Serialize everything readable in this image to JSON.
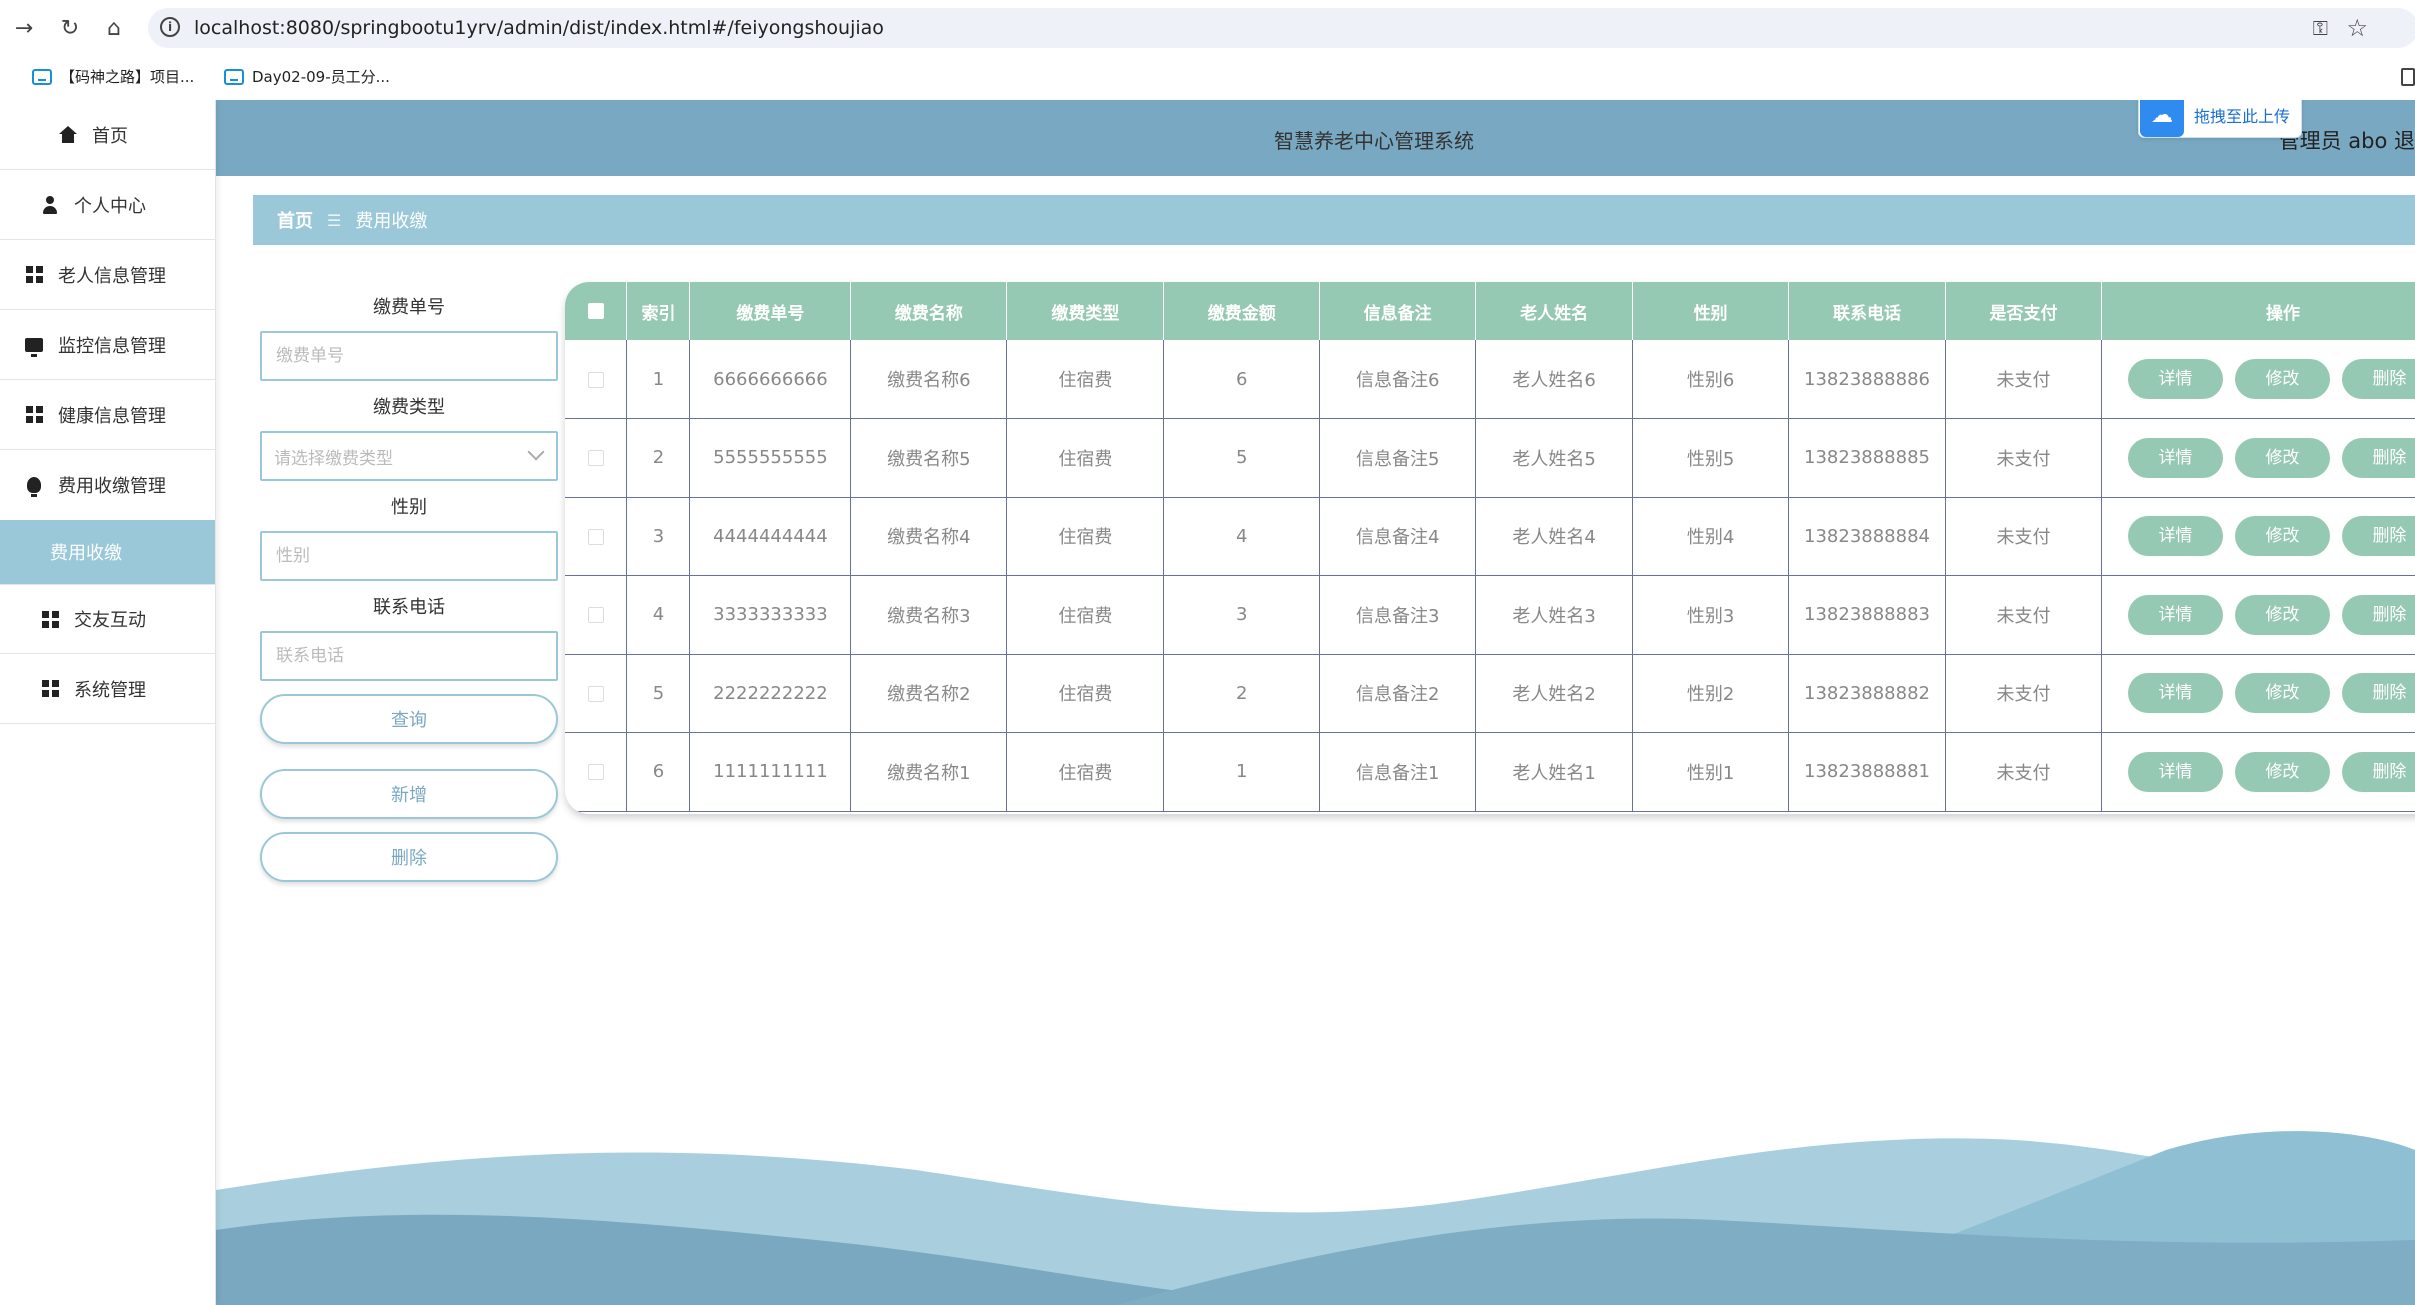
{
  "browser": {
    "url": "localhost:8080/springbootu1yrv/admin/dist/index.html#/feiyongshoujiao",
    "bookmarks": [
      "【码神之路】项目...",
      "Day02-09-员工分..."
    ]
  },
  "header": {
    "title": "智慧养老中心管理系统",
    "user": "管理员 abo  退"
  },
  "upload_chip": {
    "label": "拖拽至此上传"
  },
  "sidebar": {
    "items": [
      {
        "label": "首页",
        "icon": "home-icon"
      },
      {
        "label": "个人中心",
        "icon": "person-icon"
      },
      {
        "label": "老人信息管理",
        "icon": "grid-icon"
      },
      {
        "label": "监控信息管理",
        "icon": "monitor-icon"
      },
      {
        "label": "健康信息管理",
        "icon": "grid-icon"
      },
      {
        "label": "费用收缴管理",
        "icon": "bulb-icon"
      },
      {
        "label": "费用收缴",
        "icon": ""
      },
      {
        "label": "交友互动",
        "icon": "grid-icon"
      },
      {
        "label": "系统管理",
        "icon": "grid-icon"
      }
    ]
  },
  "breadcrumb": {
    "home": "首页",
    "separator": "☰",
    "current": "费用收缴"
  },
  "search": {
    "order_no": {
      "label": "缴费单号",
      "placeholder": "缴费单号"
    },
    "type": {
      "label": "缴费类型",
      "placeholder": "请选择缴费类型"
    },
    "gender": {
      "label": "性别",
      "placeholder": "性别"
    },
    "phone": {
      "label": "联系电话",
      "placeholder": "联系电话"
    },
    "query_label": "查询",
    "add_label": "新增",
    "delete_label": "删除"
  },
  "table": {
    "columns": [
      "索引",
      "缴费单号",
      "缴费名称",
      "缴费类型",
      "缴费金额",
      "信息备注",
      "老人姓名",
      "性别",
      "联系电话",
      "是否支付",
      "操作"
    ],
    "rows": [
      [
        "1",
        "6666666666",
        "缴费名称6",
        "住宿费",
        "6",
        "信息备注6",
        "老人姓名6",
        "性别6",
        "13823888886",
        "未支付"
      ],
      [
        "2",
        "5555555555",
        "缴费名称5",
        "住宿费",
        "5",
        "信息备注5",
        "老人姓名5",
        "性别5",
        "13823888885",
        "未支付"
      ],
      [
        "3",
        "4444444444",
        "缴费名称4",
        "住宿费",
        "4",
        "信息备注4",
        "老人姓名4",
        "性别4",
        "13823888884",
        "未支付"
      ],
      [
        "4",
        "3333333333",
        "缴费名称3",
        "住宿费",
        "3",
        "信息备注3",
        "老人姓名3",
        "性别3",
        "13823888883",
        "未支付"
      ],
      [
        "5",
        "2222222222",
        "缴费名称2",
        "住宿费",
        "2",
        "信息备注2",
        "老人姓名2",
        "性别2",
        "13823888882",
        "未支付"
      ],
      [
        "6",
        "1111111111",
        "缴费名称1",
        "住宿费",
        "1",
        "信息备注1",
        "老人姓名1",
        "性别1",
        "13823888881",
        "未支付"
      ]
    ],
    "actions": [
      "详情",
      "修改",
      "删除"
    ]
  },
  "colors": {
    "header": "#79a9c2",
    "breadcrumb": "#9ac8d8",
    "table_header": "#96c9b3",
    "button": "#96c9b3",
    "active_menu": "#9ac8d8"
  }
}
